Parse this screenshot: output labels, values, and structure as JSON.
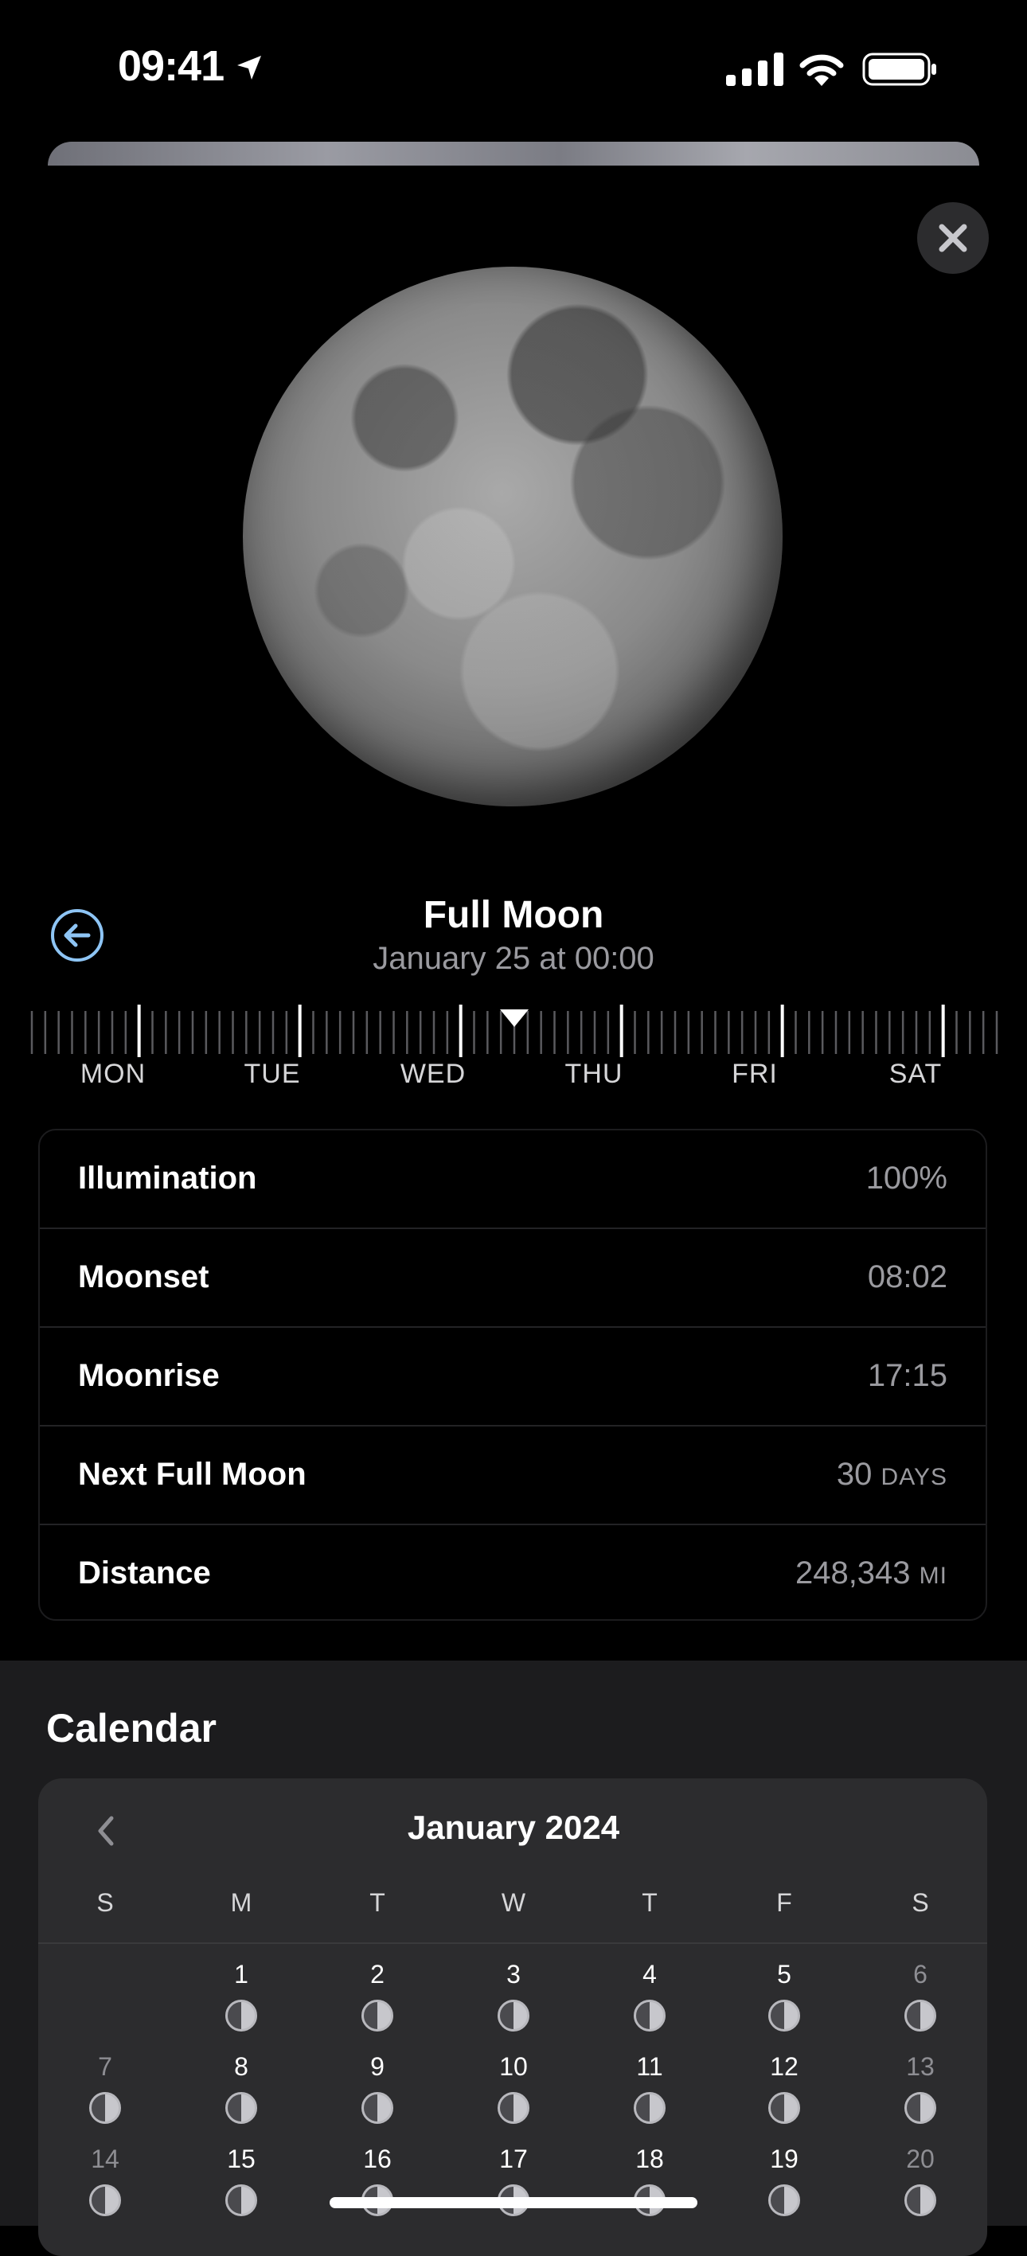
{
  "status_bar": {
    "time": "09:41"
  },
  "moon_detail": {
    "phase_name": "Full Moon",
    "date_time": "January 25 at 00:00",
    "days": [
      "MON",
      "TUE",
      "WED",
      "THU",
      "FRI",
      "SAT"
    ],
    "info": [
      {
        "label": "Illumination",
        "value": "100%",
        "unit": ""
      },
      {
        "label": "Moonset",
        "value": "08:02",
        "unit": ""
      },
      {
        "label": "Moonrise",
        "value": "17:15",
        "unit": ""
      },
      {
        "label": "Next Full Moon",
        "value": "30",
        "unit": "DAYS"
      },
      {
        "label": "Distance",
        "value": "248,343",
        "unit": "MI"
      }
    ]
  },
  "calendar": {
    "heading": "Calendar",
    "month": "January 2024",
    "weekdays": [
      "S",
      "M",
      "T",
      "W",
      "T",
      "F",
      "S"
    ],
    "weeks": [
      [
        "",
        "1",
        "2",
        "3",
        "4",
        "5",
        "6"
      ],
      [
        "7",
        "8",
        "9",
        "10",
        "11",
        "12",
        "13"
      ],
      [
        "14",
        "15",
        "16",
        "17",
        "18",
        "19",
        "20"
      ]
    ]
  }
}
